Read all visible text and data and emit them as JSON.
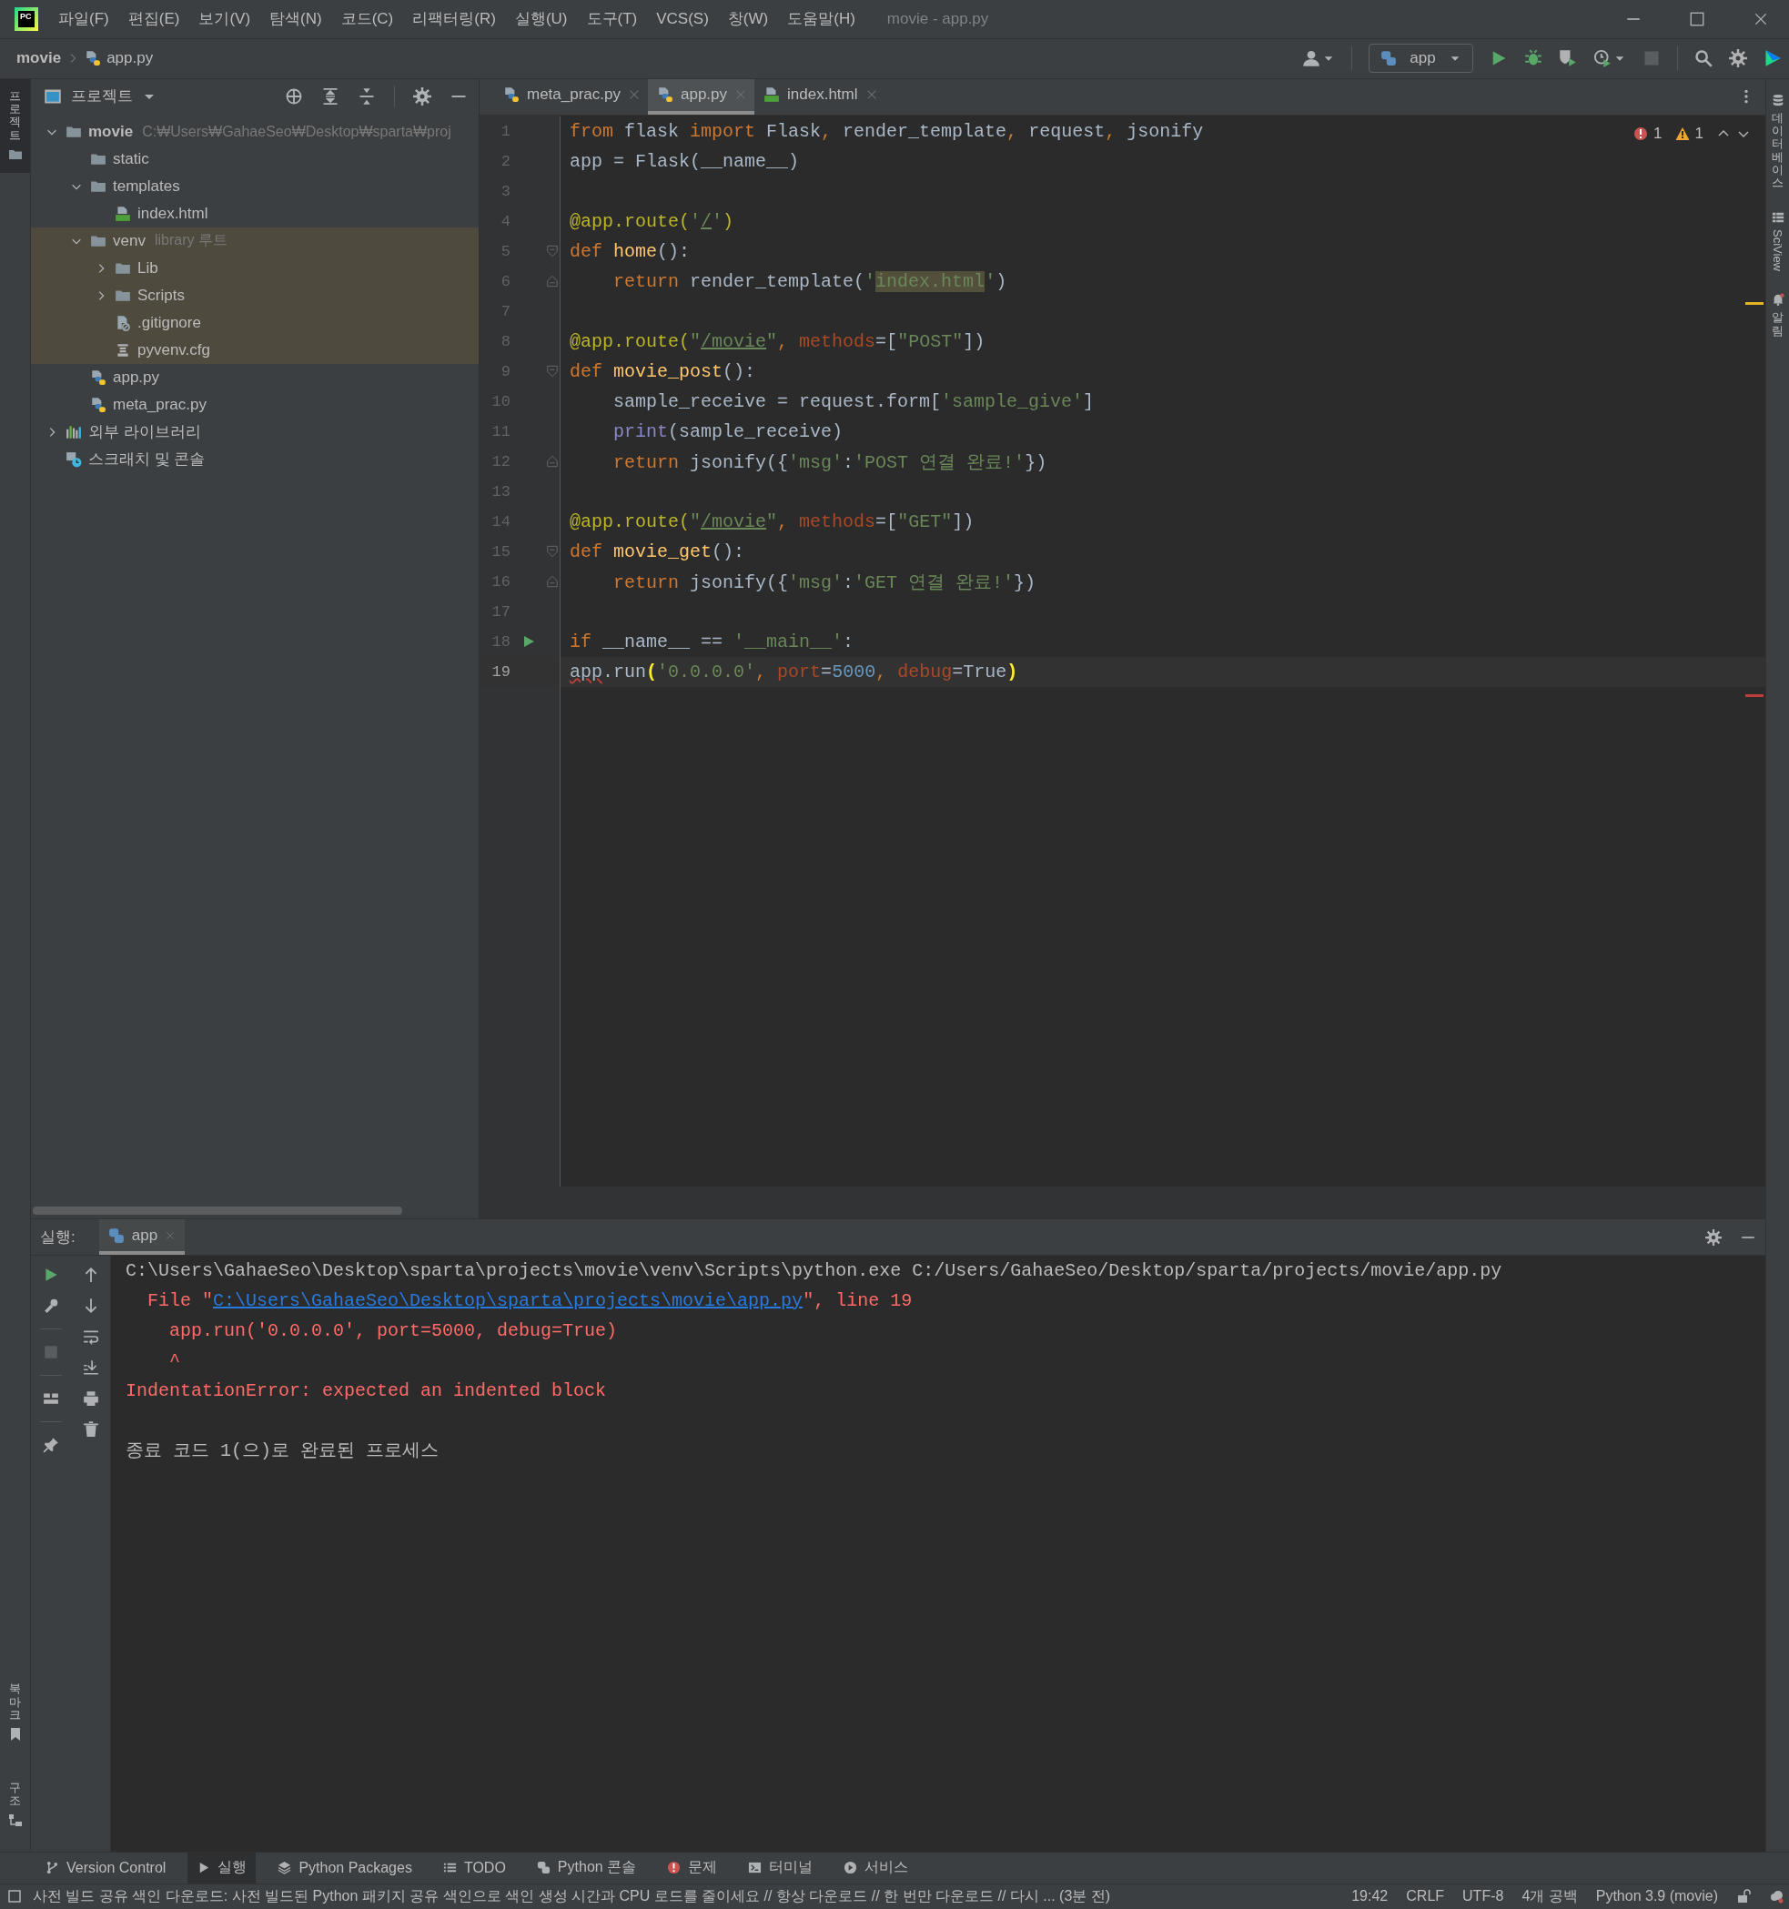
{
  "window": {
    "app_logo": "PC",
    "title": "movie - app.py"
  },
  "menu": [
    "파일(F)",
    "편집(E)",
    "보기(V)",
    "탐색(N)",
    "코드(C)",
    "리팩터링(R)",
    "실행(U)",
    "도구(T)",
    "VCS(S)",
    "창(W)",
    "도움말(H)"
  ],
  "breadcrumb": [
    "movie",
    "app.py"
  ],
  "run_config": {
    "label": "app"
  },
  "left_stripe": {
    "top": [
      {
        "label": "프로젝트",
        "selected": true
      }
    ],
    "bottom": [
      {
        "label": "북마크"
      },
      {
        "label": "구조"
      }
    ]
  },
  "right_stripe": [
    {
      "label": "데이터베이스",
      "kind": "stacked"
    },
    {
      "label": "SciView",
      "kind": "rotated"
    },
    {
      "label": "알림",
      "kind": "stacked"
    }
  ],
  "project": {
    "title": "프로젝트",
    "tree": [
      {
        "label": "movie",
        "kind": "folder",
        "hint": "C:₩Users₩GahaeSeo₩Desktop₩sparta₩proj",
        "expanded": true,
        "excluded": false,
        "children": [
          {
            "label": "static",
            "kind": "folder",
            "excluded": false
          },
          {
            "label": "templates",
            "kind": "folder",
            "expanded": true,
            "excluded": false,
            "children": [
              {
                "label": "index.html",
                "kind": "html-file",
                "excluded": false
              }
            ]
          },
          {
            "label": "venv",
            "kind": "folder",
            "hint": "library 루트",
            "expanded": true,
            "excluded": true,
            "children": [
              {
                "label": "Lib",
                "kind": "folder",
                "expanded": false,
                "excluded": true
              },
              {
                "label": "Scripts",
                "kind": "folder",
                "expanded": false,
                "excluded": true
              },
              {
                "label": ".gitignore",
                "kind": "ignored-file",
                "excluded": true
              },
              {
                "label": "pyvenv.cfg",
                "kind": "config-file",
                "excluded": true
              }
            ]
          },
          {
            "label": "app.py",
            "kind": "python-file",
            "excluded": false
          },
          {
            "label": "meta_prac.py",
            "kind": "python-file",
            "excluded": false
          }
        ]
      },
      {
        "label": "외부 라이브러리",
        "kind": "library",
        "expanded": false,
        "excluded": false
      },
      {
        "label": "스크래치 및 콘솔",
        "kind": "scratch",
        "excluded": false
      }
    ]
  },
  "editor": {
    "tabs": [
      {
        "label": "meta_prac.py",
        "kind": "python-file",
        "selected": false
      },
      {
        "label": "app.py",
        "kind": "python-file",
        "selected": true
      },
      {
        "label": "index.html",
        "kind": "html-file",
        "selected": false
      }
    ],
    "problems": {
      "errors": "1",
      "warnings": "1"
    },
    "lines": [
      {
        "number": "1",
        "current": false,
        "tokens": [
          {
            "kind": "keyword",
            "text": "from"
          },
          {
            "kind": "plain",
            "text": " flask "
          },
          {
            "kind": "keyword",
            "text": "import"
          },
          {
            "kind": "plain",
            "text": " Flask"
          },
          {
            "kind": "keyword",
            "text": ","
          },
          {
            "kind": "plain",
            "text": " render_template"
          },
          {
            "kind": "keyword",
            "text": ","
          },
          {
            "kind": "plain",
            "text": " request"
          },
          {
            "kind": "keyword",
            "text": ","
          },
          {
            "kind": "plain",
            "text": " jsonify"
          }
        ]
      },
      {
        "number": "2",
        "current": false,
        "tokens": [
          {
            "kind": "plain",
            "text": "app = Flask(__name__)"
          }
        ]
      },
      {
        "number": "3",
        "current": false
      },
      {
        "number": "4",
        "current": false,
        "tokens": [
          {
            "kind": "decorator",
            "text": "@app.route("
          },
          {
            "kind": "string",
            "text": "'"
          },
          {
            "kind": "string-link",
            "text": "/"
          },
          {
            "kind": "string",
            "text": "'"
          },
          {
            "kind": "decorator",
            "text": ")"
          }
        ]
      },
      {
        "number": "5",
        "current": false,
        "kind": "fold-open",
        "tokens": [
          {
            "kind": "keyword",
            "text": "def"
          },
          {
            "kind": "function",
            "text": " home"
          },
          {
            "kind": "plain",
            "text": "():"
          }
        ]
      },
      {
        "number": "6",
        "current": false,
        "kind": "fold-close",
        "tokens": [
          {
            "kind": "keyword",
            "text": "    return"
          },
          {
            "kind": "plain",
            "text": " render_template("
          },
          {
            "kind": "string",
            "text": "'"
          },
          {
            "kind": "string-match",
            "text": "index.html"
          },
          {
            "kind": "string",
            "text": "'"
          },
          {
            "kind": "plain",
            "text": ")"
          }
        ]
      },
      {
        "number": "7",
        "current": false
      },
      {
        "number": "8",
        "current": false,
        "tokens": [
          {
            "kind": "decorator",
            "text": "@app.route("
          },
          {
            "kind": "string",
            "text": "\""
          },
          {
            "kind": "string-link",
            "text": "/movie"
          },
          {
            "kind": "string",
            "text": "\""
          },
          {
            "kind": "keyword",
            "text": ", "
          },
          {
            "kind": "argument",
            "text": "methods"
          },
          {
            "kind": "plain",
            "text": "=["
          },
          {
            "kind": "string",
            "text": "\"POST\""
          },
          {
            "kind": "plain",
            "text": "])"
          }
        ]
      },
      {
        "number": "9",
        "current": false,
        "kind": "fold-open",
        "tokens": [
          {
            "kind": "keyword",
            "text": "def"
          },
          {
            "kind": "function",
            "text": " movie_post"
          },
          {
            "kind": "plain",
            "text": "():"
          }
        ]
      },
      {
        "number": "10",
        "current": false,
        "tokens": [
          {
            "kind": "plain",
            "text": "    sample_receive = request.form["
          },
          {
            "kind": "string",
            "text": "'sample_give'"
          },
          {
            "kind": "plain",
            "text": "]"
          }
        ]
      },
      {
        "number": "11",
        "current": false,
        "tokens": [
          {
            "kind": "builtin",
            "text": "    print"
          },
          {
            "kind": "plain",
            "text": "(sample_receive)"
          }
        ]
      },
      {
        "number": "12",
        "current": false,
        "kind": "fold-close",
        "tokens": [
          {
            "kind": "keyword",
            "text": "    return"
          },
          {
            "kind": "plain",
            "text": " jsonify({"
          },
          {
            "kind": "string",
            "text": "'msg'"
          },
          {
            "kind": "plain",
            "text": ":"
          },
          {
            "kind": "string",
            "text": "'POST 연결 완료!'"
          },
          {
            "kind": "plain",
            "text": "})"
          }
        ]
      },
      {
        "number": "13",
        "current": false
      },
      {
        "number": "14",
        "current": false,
        "tokens": [
          {
            "kind": "decorator",
            "text": "@app.route("
          },
          {
            "kind": "string",
            "text": "\""
          },
          {
            "kind": "string-link",
            "text": "/movie"
          },
          {
            "kind": "string",
            "text": "\""
          },
          {
            "kind": "keyword",
            "text": ", "
          },
          {
            "kind": "argument",
            "text": "methods"
          },
          {
            "kind": "plain",
            "text": "=["
          },
          {
            "kind": "string",
            "text": "\"GET\""
          },
          {
            "kind": "plain",
            "text": "])"
          }
        ]
      },
      {
        "number": "15",
        "current": false,
        "kind": "fold-open",
        "tokens": [
          {
            "kind": "keyword",
            "text": "def"
          },
          {
            "kind": "function",
            "text": " movie_get"
          },
          {
            "kind": "plain",
            "text": "():"
          }
        ]
      },
      {
        "number": "16",
        "current": false,
        "kind": "fold-close",
        "tokens": [
          {
            "kind": "keyword",
            "text": "    return"
          },
          {
            "kind": "plain",
            "text": " jsonify({"
          },
          {
            "kind": "string",
            "text": "'msg'"
          },
          {
            "kind": "plain",
            "text": ":"
          },
          {
            "kind": "string",
            "text": "'GET 연결 완료!'"
          },
          {
            "kind": "plain",
            "text": "})"
          }
        ]
      },
      {
        "number": "17",
        "current": false
      },
      {
        "number": "18",
        "current": false,
        "kind": "run",
        "tokens": [
          {
            "kind": "keyword",
            "text": "if"
          },
          {
            "kind": "plain",
            "text": " __name__ == "
          },
          {
            "kind": "string",
            "text": "'__main__'"
          },
          {
            "kind": "plain",
            "text": ":"
          }
        ]
      },
      {
        "number": "19",
        "current": true,
        "tokens": [
          {
            "kind": "error",
            "text": "app"
          },
          {
            "kind": "plain",
            "text": ".run"
          },
          {
            "kind": "brace",
            "text": "("
          },
          {
            "kind": "string",
            "text": "'0.0.0.0'"
          },
          {
            "kind": "keyword",
            "text": ", "
          },
          {
            "kind": "argument",
            "text": "port"
          },
          {
            "kind": "plain",
            "text": "="
          },
          {
            "kind": "number",
            "text": "5000"
          },
          {
            "kind": "keyword",
            "text": ", "
          },
          {
            "kind": "argument",
            "text": "debug"
          },
          {
            "kind": "plain",
            "text": "="
          },
          {
            "kind": "plain",
            "text": "True"
          },
          {
            "kind": "brace",
            "text": ")"
          }
        ]
      }
    ]
  },
  "run": {
    "label": "실행:",
    "tabs": [
      {
        "label": "app",
        "selected": true
      }
    ],
    "console": [
      {
        "kind": "command",
        "text": "C:\\Users\\GahaeSeo\\Desktop\\sparta\\projects\\movie\\venv\\Scripts\\python.exe C:/Users/GahaeSeo/Desktop/sparta/projects/movie/app.py"
      },
      {
        "kind": "error",
        "text": "  File \"",
        "link": "C:\\Users\\GahaeSeo\\Desktop\\sparta\\projects\\movie\\app.py",
        "after": "\", line 19"
      },
      {
        "kind": "error",
        "text": "    app.run('0.0.0.0', port=5000, debug=True)"
      },
      {
        "kind": "error",
        "text": "    ^"
      },
      {
        "kind": "error",
        "text": "IndentationError: expected an indented block"
      },
      {
        "kind": "exit",
        "text": "종료 코드 1(으)로 완료된 프로세스"
      }
    ]
  },
  "tool_windows": [
    {
      "label": "Version Control",
      "selected": false
    },
    {
      "label": "실행",
      "selected": true
    },
    {
      "label": "Python Packages",
      "selected": false
    },
    {
      "label": "TODO",
      "selected": false
    },
    {
      "label": "Python 콘솔",
      "selected": false
    },
    {
      "label": "문제",
      "selected": false
    },
    {
      "label": "터미널",
      "selected": false
    },
    {
      "label": "서비스",
      "selected": false
    }
  ],
  "status": {
    "message": "사전 빌드 공유 색인 다운로드: 사전 빌드된 Python 패키지 공유 색인으로 색인 생성 시간과 CPU 로드를 줄이세요 // 항상 다운로드 // 한 번만 다운로드 // 다시 ... (3분 전)",
    "items": [
      "19:42",
      "CRLF",
      "UTF-8",
      "4개 공백",
      "Python 3.9 (movie)"
    ]
  }
}
